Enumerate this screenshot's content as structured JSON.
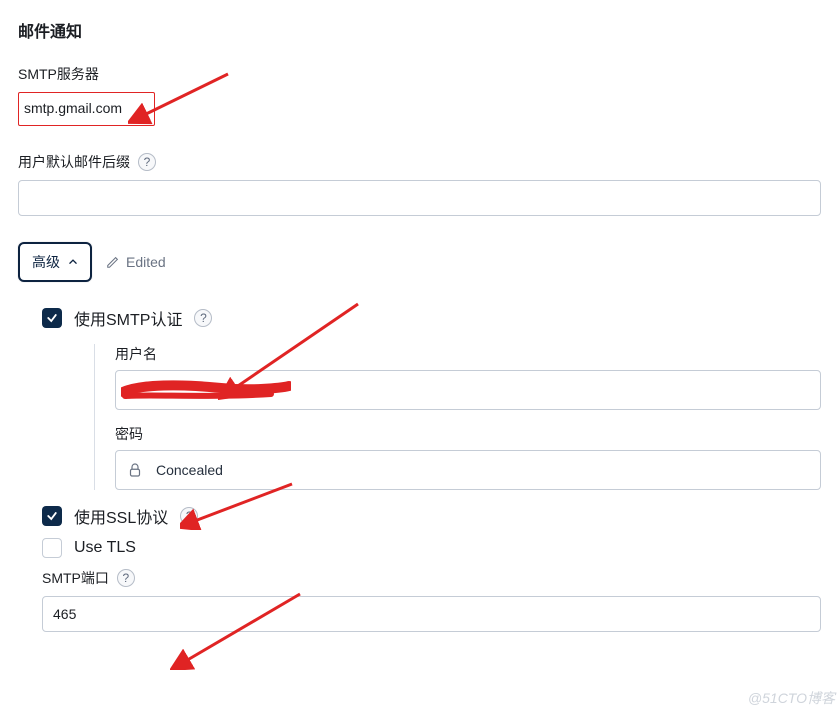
{
  "section_title": "邮件通知",
  "smtp": {
    "label": "SMTP服务器",
    "value": "smtp.gmail.com"
  },
  "suffix": {
    "label": "用户默认邮件后缀",
    "value": ""
  },
  "advanced": {
    "button": "高级",
    "edited": "Edited"
  },
  "auth": {
    "checkbox_label": "使用SMTP认证",
    "checked": true,
    "username_label": "用户名",
    "username_value": "",
    "password_label": "密码",
    "concealed_text": "Concealed"
  },
  "ssl": {
    "label": "使用SSL协议",
    "checked": true
  },
  "tls": {
    "label": "Use TLS",
    "checked": false
  },
  "port": {
    "label": "SMTP端口",
    "value": "465"
  },
  "watermark": "@51CTO博客",
  "help_glyph": "?"
}
